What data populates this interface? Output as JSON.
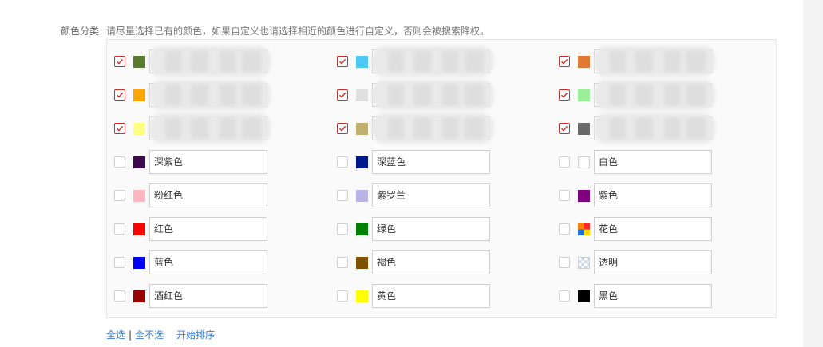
{
  "section": {
    "label": "颜色分类",
    "hint": "请尽量选择已有的颜色，如果自定义也请选择相近的颜色进行自定义，否则会被搜索降权。"
  },
  "colors": [
    {
      "name": "",
      "color": "#5a7a2e",
      "checked": true
    },
    {
      "name": "",
      "color": "#4cc8f5",
      "checked": true
    },
    {
      "name": "",
      "color": "#e07a35",
      "checked": true
    },
    {
      "name": "",
      "color": "#ffa500",
      "checked": true
    },
    {
      "name": "",
      "color": "#e0e0e0",
      "checked": true
    },
    {
      "name": "",
      "color": "#9cf09a",
      "checked": true
    },
    {
      "name": "",
      "color": "#ffff80",
      "checked": true
    },
    {
      "name": "",
      "color": "#bfb070",
      "checked": true
    },
    {
      "name": "",
      "color": "#6a6a6a",
      "checked": true
    },
    {
      "name": "深紫色",
      "color": "#3b0a4d",
      "checked": false
    },
    {
      "name": "深蓝色",
      "color": "#00198c",
      "checked": false
    },
    {
      "name": "白色",
      "color": "#ffffff",
      "checked": false
    },
    {
      "name": "粉红色",
      "color": "#ffb6c1",
      "checked": false
    },
    {
      "name": "紫罗兰",
      "color": "#b9b3e6",
      "checked": false
    },
    {
      "name": "紫色",
      "color": "#800080",
      "checked": false
    },
    {
      "name": "红色",
      "color": "#ff0000",
      "checked": false
    },
    {
      "name": "绿色",
      "color": "#008000",
      "checked": false
    },
    {
      "name": "花色",
      "color": "multicolor",
      "checked": false
    },
    {
      "name": "蓝色",
      "color": "#0000ff",
      "checked": false
    },
    {
      "name": "褐色",
      "color": "#7f5200",
      "checked": false
    },
    {
      "name": "透明",
      "color": "transparent",
      "checked": false
    },
    {
      "name": "酒红色",
      "color": "#990000",
      "checked": false
    },
    {
      "name": "黄色",
      "color": "#ffff00",
      "checked": false
    },
    {
      "name": "黑色",
      "color": "#000000",
      "checked": false
    }
  ],
  "actions": {
    "select_all": "全选",
    "separator": "|",
    "select_none": "全不选",
    "start_sort": "开始排序"
  }
}
